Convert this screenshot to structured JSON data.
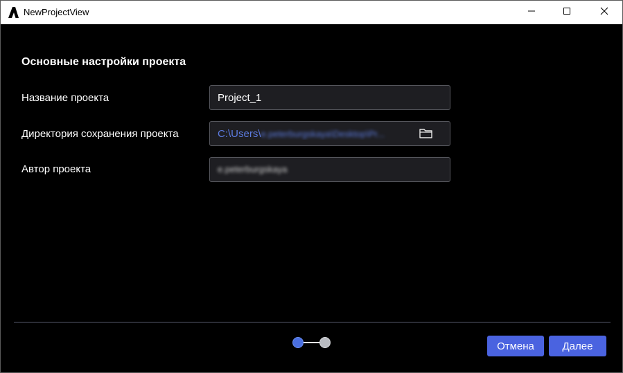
{
  "window": {
    "title": "NewProjectView"
  },
  "section": {
    "title": "Основные настройки проекта"
  },
  "fields": {
    "name": {
      "label": "Название проекта",
      "value": "Project_1"
    },
    "directory": {
      "label": "Директория сохранения проекта",
      "value_prefix": "C:\\Users\\",
      "value_obscured": "e.peterburgskaya\\Desktop\\Pr..."
    },
    "author": {
      "label": "Автор проекта",
      "value_obscured": "e.peterburgskaya"
    }
  },
  "stepper": {
    "current_step": 1,
    "total_steps": 2
  },
  "buttons": {
    "cancel_label": "Отмена",
    "next_label": "Далее"
  },
  "colors": {
    "accent": "#4a63e0",
    "background": "#000000",
    "input_background": "#1e1e22",
    "path_text": "#5c7be0"
  },
  "icons": {
    "app": "app-logo-icon",
    "folder": "folder-icon",
    "minimize": "minimize-icon",
    "maximize": "maximize-icon",
    "close": "close-icon"
  }
}
